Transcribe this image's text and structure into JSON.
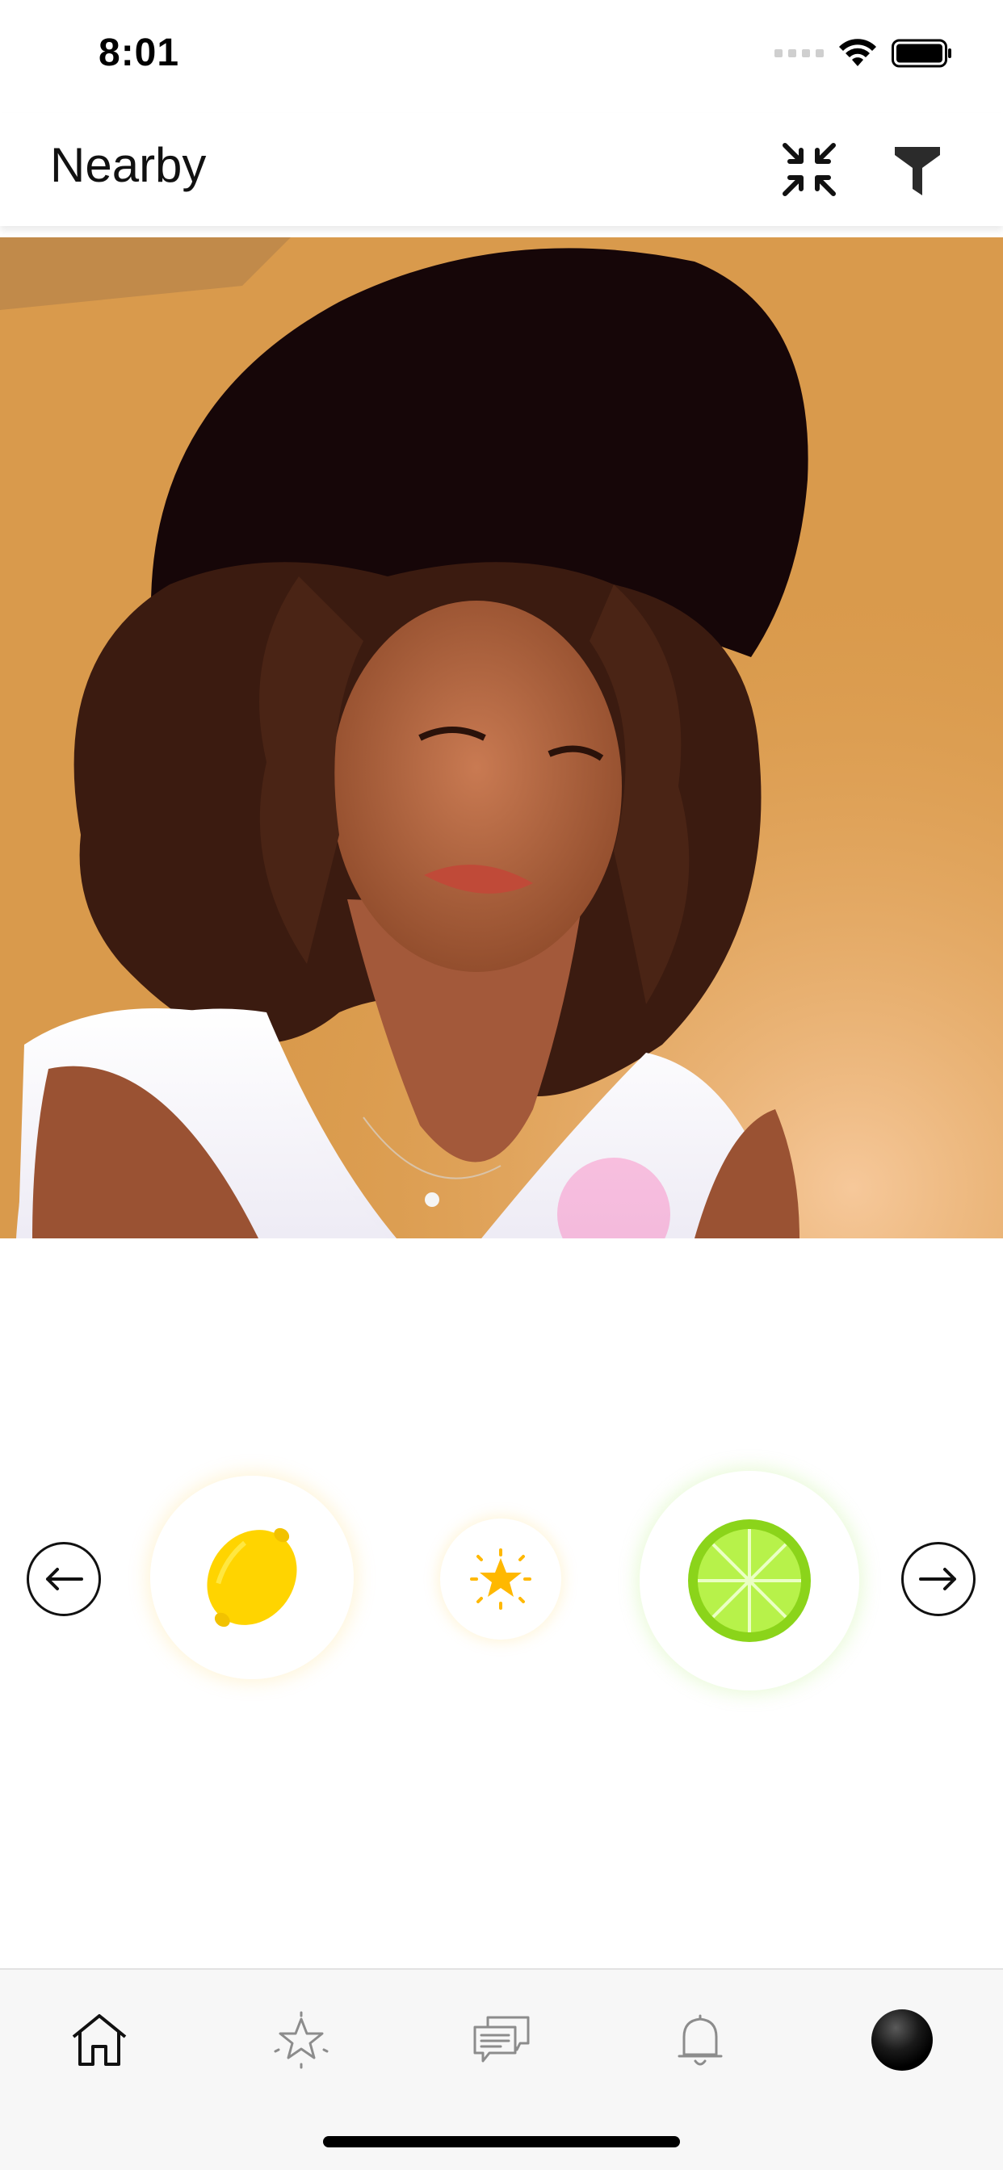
{
  "status_bar": {
    "time": "8:01",
    "icons": [
      "signal-icon",
      "wifi-icon",
      "battery-icon"
    ]
  },
  "header": {
    "title": "Nearby",
    "icons": [
      "collapse-icon",
      "filter-icon"
    ]
  },
  "photo": {
    "subject": "profile-photo"
  },
  "actions": {
    "icons": [
      "arrow-left-icon",
      "lemon-icon",
      "star-icon",
      "lime-icon",
      "arrow-right-icon"
    ],
    "colors": {
      "lemon": "#ffd400",
      "star": "#ffb800",
      "lime": "#8bd41a"
    }
  },
  "tab_bar": {
    "items": [
      "home-icon",
      "favorites-icon",
      "messages-icon",
      "notifications-icon",
      "profile-avatar"
    ],
    "active": "home"
  }
}
